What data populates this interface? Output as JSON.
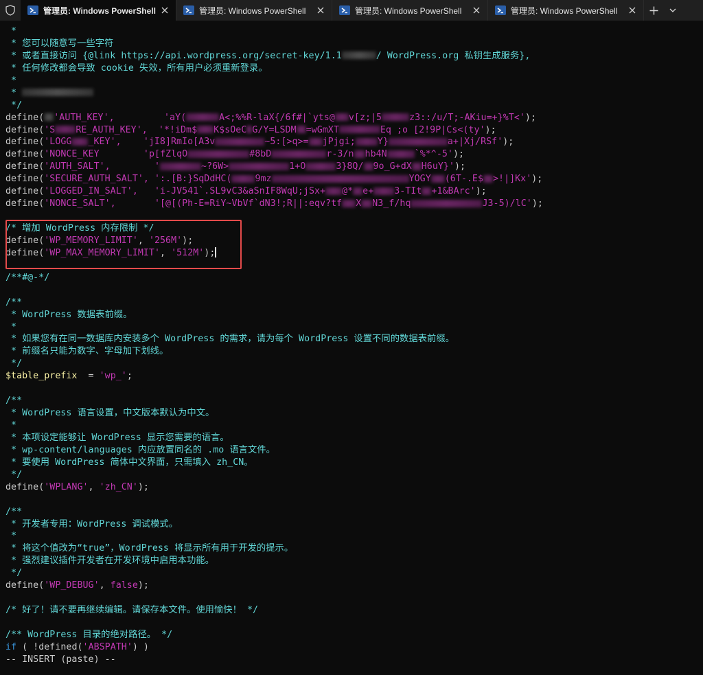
{
  "tabs": [
    {
      "title": "管理员: Windows PowerShell",
      "active": true
    },
    {
      "title": "管理员: Windows PowerShell",
      "active": false
    },
    {
      "title": "管理员: Windows PowerShell",
      "active": false
    },
    {
      "title": "管理员: Windows PowerShell",
      "active": false
    }
  ],
  "icons": {
    "shield": "shield-icon",
    "powershell": "powershell-icon",
    "close": "close-icon",
    "new_tab": "plus-icon",
    "dropdown": "chevron-down-icon"
  },
  "colors": {
    "comment": "#61d6d6",
    "string": "#c239b3",
    "keyword": "#3a96dd",
    "variable": "#f9f1a5",
    "highlight_border": "#e54b4b"
  },
  "code": {
    "c1": " *",
    "c2": " * 您可以随意写一些字符",
    "c3": " * 或者直接访问 {@link https://api.wordpress.org/secret-key/1.1",
    "c3b": "/ WordPress.org 私钥生成服务},",
    "c4": " * 任何修改都会导致 cookie 失效，所有用户必须重新登录。",
    "c5": " *",
    "c6": " * ",
    "c7": " */",
    "keys": [
      {
        "a": "define(",
        "k": "'AUTH_KEY',",
        "pad": "         ",
        "v1": "'aY(",
        "v2": "A<;%%R-laX{/6f#|`yts@",
        "v3": "v[z;|5",
        "v4": "z3::/u/T;-AKiu=+}%T<'",
        "end": ");"
      },
      {
        "a": "define(",
        "k": "'S",
        "k2": "RE_AUTH_KEY',",
        "pad": "  ",
        "v1": "'*!iDm$",
        "v2": "K$sOeC",
        "v3": "G/Y=LSDM",
        "v4": "=wGmXT",
        "v5": "Eq ;o [2!9P|Cs<(ty'",
        "end": ");"
      },
      {
        "a": "define(",
        "k": "'LOGG",
        "k2": "_KEY',",
        "pad": "    ",
        "v1": "'jI8]RmIo[A3v",
        "v2": "~5:[>q>=",
        "v3": "jPjgi;",
        "v4": "Y}",
        "v5": "a+|Xj/RSf'",
        "end": ");"
      },
      {
        "a": "define(",
        "k": "'NONCE_KEY",
        "pad": "        ",
        "v1": "'p[fZlqO",
        "v2": "#8bD",
        "v3": "r-3/n",
        "v4": "hb4N",
        "v5": "`%*^-5'",
        "end": ");"
      },
      {
        "a": "define(",
        "k": "'AUTH_SALT',",
        "pad": "        ",
        "v1": "'",
        "v2": "~?6W>",
        "v3": "1+O",
        "v4": "3}8Q/",
        "v5": "9o_G+dX",
        "v6": "H6uY}'",
        "end": ");"
      },
      {
        "a": "define(",
        "k": "'SECURE_AUTH_SALT',",
        "pad": " ",
        "v1": "':.[B:}SqDdHC(",
        "v2": "9mz",
        "v3": "YOGY",
        "v4": "(6T-.E$",
        "v5": ">!|]Kx'",
        "end": ");"
      },
      {
        "a": "define(",
        "k": "'LOGGED_IN_SALT',",
        "pad": "   ",
        "v1": "'i-JV541`.SL9vC3&aSnIF8WqU;jSx+",
        "v2": "@*",
        "v3": "e+",
        "v4": "3-TIt",
        "v5": "+1&BArc'",
        "end": ");"
      },
      {
        "a": "define(",
        "k": "'NONCE_SALT',",
        "pad": "       ",
        "v1": "'[@[(Ph-E=RiY~VbVf`dN3!;R||:eqv?tf",
        "v2": "X",
        "v3": "N3_f/hq",
        "v4": "J3-5)/lC'",
        "end": ");"
      }
    ],
    "blank": " ",
    "mem_comment": "/* 增加 WordPress 内存限制 */",
    "mem1_fn": "define(",
    "mem1_key": "'WP_MEMORY_LIMIT'",
    "mem1_sep": ", ",
    "mem1_val": "'256M'",
    "mem1_end": ");",
    "mem2_fn": "define(",
    "mem2_key": "'WP_MAX_MEMORY_LIMIT'",
    "mem2_sep": ", ",
    "mem2_val": "'512M'",
    "mem2_end": ");",
    "marker": "/**#@-*/",
    "p1": "/**",
    "p2": " * WordPress 数据表前缀。",
    "p3": " *",
    "p4": " * 如果您有在同一数据库内安装多个 WordPress 的需求，请为每个 WordPress 设置不同的数据表前缀。",
    "p5": " * 前缀名只能为数字、字母加下划线。",
    "p6": " */",
    "prefix_var": "$table_prefix",
    "prefix_eq": "  = ",
    "prefix_val": "'wp_'",
    "prefix_end": ";",
    "l1": "/**",
    "l2": " * WordPress 语言设置，中文版本默认为中文。",
    "l3": " *",
    "l4": " * 本项设定能够让 WordPress 显示您需要的语言。",
    "l5": " * wp-content/languages 内应放置同名的 .mo 语言文件。",
    "l6": " * 要使用 WordPress 简体中文界面，只需填入 zh_CN。",
    "l7": " */",
    "lang_fn": "define(",
    "lang_key": "'WPLANG'",
    "lang_sep": ", ",
    "lang_val": "'zh_CN'",
    "lang_end": ");",
    "d1": "/**",
    "d2": " * 开发者专用：WordPress 调试模式。",
    "d3": " *",
    "d4": " * 将这个值改为“true”，WordPress 将显示所有用于开发的提示。",
    "d5": " * 强烈建议插件开发者在开发环境中启用本功能。",
    "d6": " */",
    "debug_fn": "define(",
    "debug_key": "'WP_DEBUG'",
    "debug_sep": ", ",
    "debug_val": "false",
    "debug_end": ");",
    "end_comment": "/* 好了！请不要再继续编辑。请保存本文件。使用愉快！ */",
    "abs_comment": "/** WordPress 目录的绝对路径。 */",
    "if_kw": "if",
    "if_open": " ( !",
    "if_fn": "defined",
    "if_paren": "(",
    "if_val": "'ABSPATH'",
    "if_close": ") )",
    "mode": "-- INSERT (paste) --"
  }
}
